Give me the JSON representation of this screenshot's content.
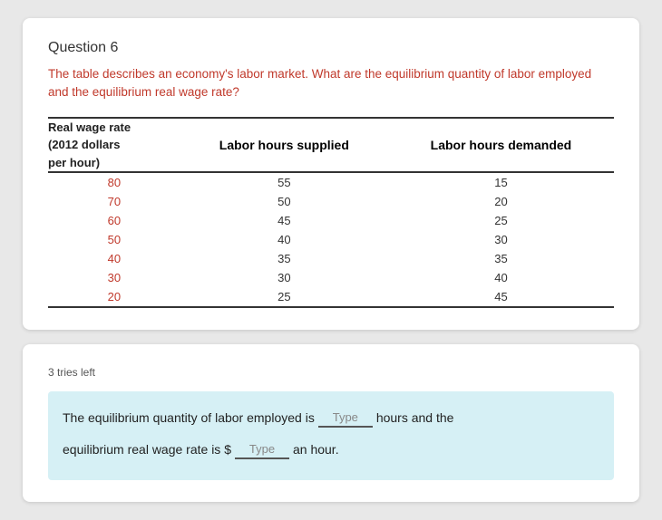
{
  "question": {
    "title": "Question 6",
    "text": "The table describes an economy's labor market. What are the equilibrium\nquantity of labor employed and the equilibrium real wage rate?",
    "table": {
      "col1_header_line1": "Real wage rate",
      "col1_header_line2": "(2012 dollars",
      "col1_header_line3": "per hour)",
      "col2_header": "Labor hours supplied",
      "col3_header": "Labor hours demanded",
      "rows": [
        {
          "wage": "80",
          "supplied": "55",
          "demanded": "15"
        },
        {
          "wage": "70",
          "supplied": "50",
          "demanded": "20"
        },
        {
          "wage": "60",
          "supplied": "45",
          "demanded": "25"
        },
        {
          "wage": "50",
          "supplied": "40",
          "demanded": "30"
        },
        {
          "wage": "40",
          "supplied": "35",
          "demanded": "35"
        },
        {
          "wage": "30",
          "supplied": "30",
          "demanded": "40"
        },
        {
          "wage": "20",
          "supplied": "25",
          "demanded": "45"
        }
      ]
    }
  },
  "answer_section": {
    "tries_label": "3 tries left",
    "line1_before": "The equilibrium quantity of labor employed is",
    "line1_input_placeholder": "Type",
    "line1_after": "hours and the",
    "line2_before": "equilibrium real wage rate is $",
    "line2_input_placeholder": "Type",
    "line2_after": "an hour."
  }
}
